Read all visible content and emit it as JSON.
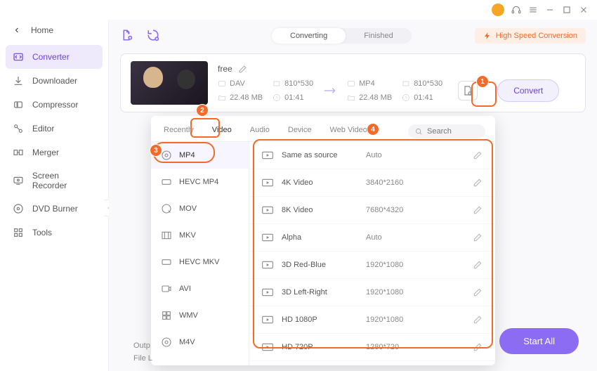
{
  "titlebar": {
    "icons": [
      "avatar",
      "headset",
      "hamburger",
      "minimize",
      "maximize",
      "close"
    ]
  },
  "sidebar": {
    "home": "Home",
    "items": [
      {
        "label": "Converter",
        "icon": "converter",
        "active": true
      },
      {
        "label": "Downloader",
        "icon": "downloader"
      },
      {
        "label": "Compressor",
        "icon": "compressor"
      },
      {
        "label": "Editor",
        "icon": "editor"
      },
      {
        "label": "Merger",
        "icon": "merger"
      },
      {
        "label": "Screen Recorder",
        "icon": "screen-recorder"
      },
      {
        "label": "DVD Burner",
        "icon": "dvd-burner"
      },
      {
        "label": "Tools",
        "icon": "tools"
      }
    ]
  },
  "topbar": {
    "seg": {
      "converting": "Converting",
      "finished": "Finished"
    },
    "hsc": "High Speed Conversion"
  },
  "file": {
    "name": "free",
    "src": {
      "format": "DAV",
      "res": "810*530",
      "size": "22.48 MB",
      "dur": "01:41"
    },
    "dst": {
      "format": "MP4",
      "res": "810*530",
      "size": "22.48 MB",
      "dur": "01:41"
    },
    "convert": "Convert"
  },
  "dropdown": {
    "tabs": [
      "Recently",
      "Video",
      "Audio",
      "Device",
      "Web Video"
    ],
    "active_tab": 1,
    "search_placeholder": "Search",
    "formats": [
      "MP4",
      "HEVC MP4",
      "MOV",
      "MKV",
      "HEVC MKV",
      "AVI",
      "WMV",
      "M4V"
    ],
    "active_format": 0,
    "presets": [
      {
        "name": "Same as source",
        "res": "Auto"
      },
      {
        "name": "4K Video",
        "res": "3840*2160"
      },
      {
        "name": "8K Video",
        "res": "7680*4320"
      },
      {
        "name": "Alpha",
        "res": "Auto"
      },
      {
        "name": "3D Red-Blue",
        "res": "1920*1080"
      },
      {
        "name": "3D Left-Right",
        "res": "1920*1080"
      },
      {
        "name": "HD 1080P",
        "res": "1920*1080"
      },
      {
        "name": "HD 720P",
        "res": "1280*720"
      }
    ]
  },
  "footer": {
    "output": "Outp",
    "filell": "File L"
  },
  "start_all": "Start All",
  "badges": {
    "b1": "1",
    "b2": "2",
    "b3": "3",
    "b4": "4"
  }
}
